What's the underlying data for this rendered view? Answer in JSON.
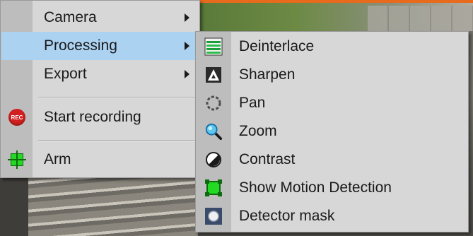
{
  "main_menu": {
    "items": [
      {
        "label": "Camera",
        "has_submenu": true
      },
      {
        "label": "Processing",
        "has_submenu": true,
        "selected": true
      },
      {
        "label": "Export",
        "has_submenu": true
      },
      {
        "label": "Start recording",
        "icon": "record-icon",
        "icon_text": "REC"
      },
      {
        "label": "Arm",
        "icon": "arm-icon"
      }
    ]
  },
  "submenu": {
    "items": [
      {
        "label": "Deinterlace",
        "icon": "deinterlace-icon"
      },
      {
        "label": "Sharpen",
        "icon": "sharpen-icon"
      },
      {
        "label": "Pan",
        "icon": "pan-icon"
      },
      {
        "label": "Zoom",
        "icon": "zoom-icon"
      },
      {
        "label": "Contrast",
        "icon": "contrast-icon"
      },
      {
        "label": "Show Motion Detection",
        "icon": "motion-detection-icon"
      },
      {
        "label": "Detector mask",
        "icon": "detector-mask-icon"
      }
    ]
  },
  "colors": {
    "selection": "#acd2f2",
    "menu_bg": "#d7d7d7",
    "record": "#d21f1f",
    "arm": "#23d923"
  }
}
